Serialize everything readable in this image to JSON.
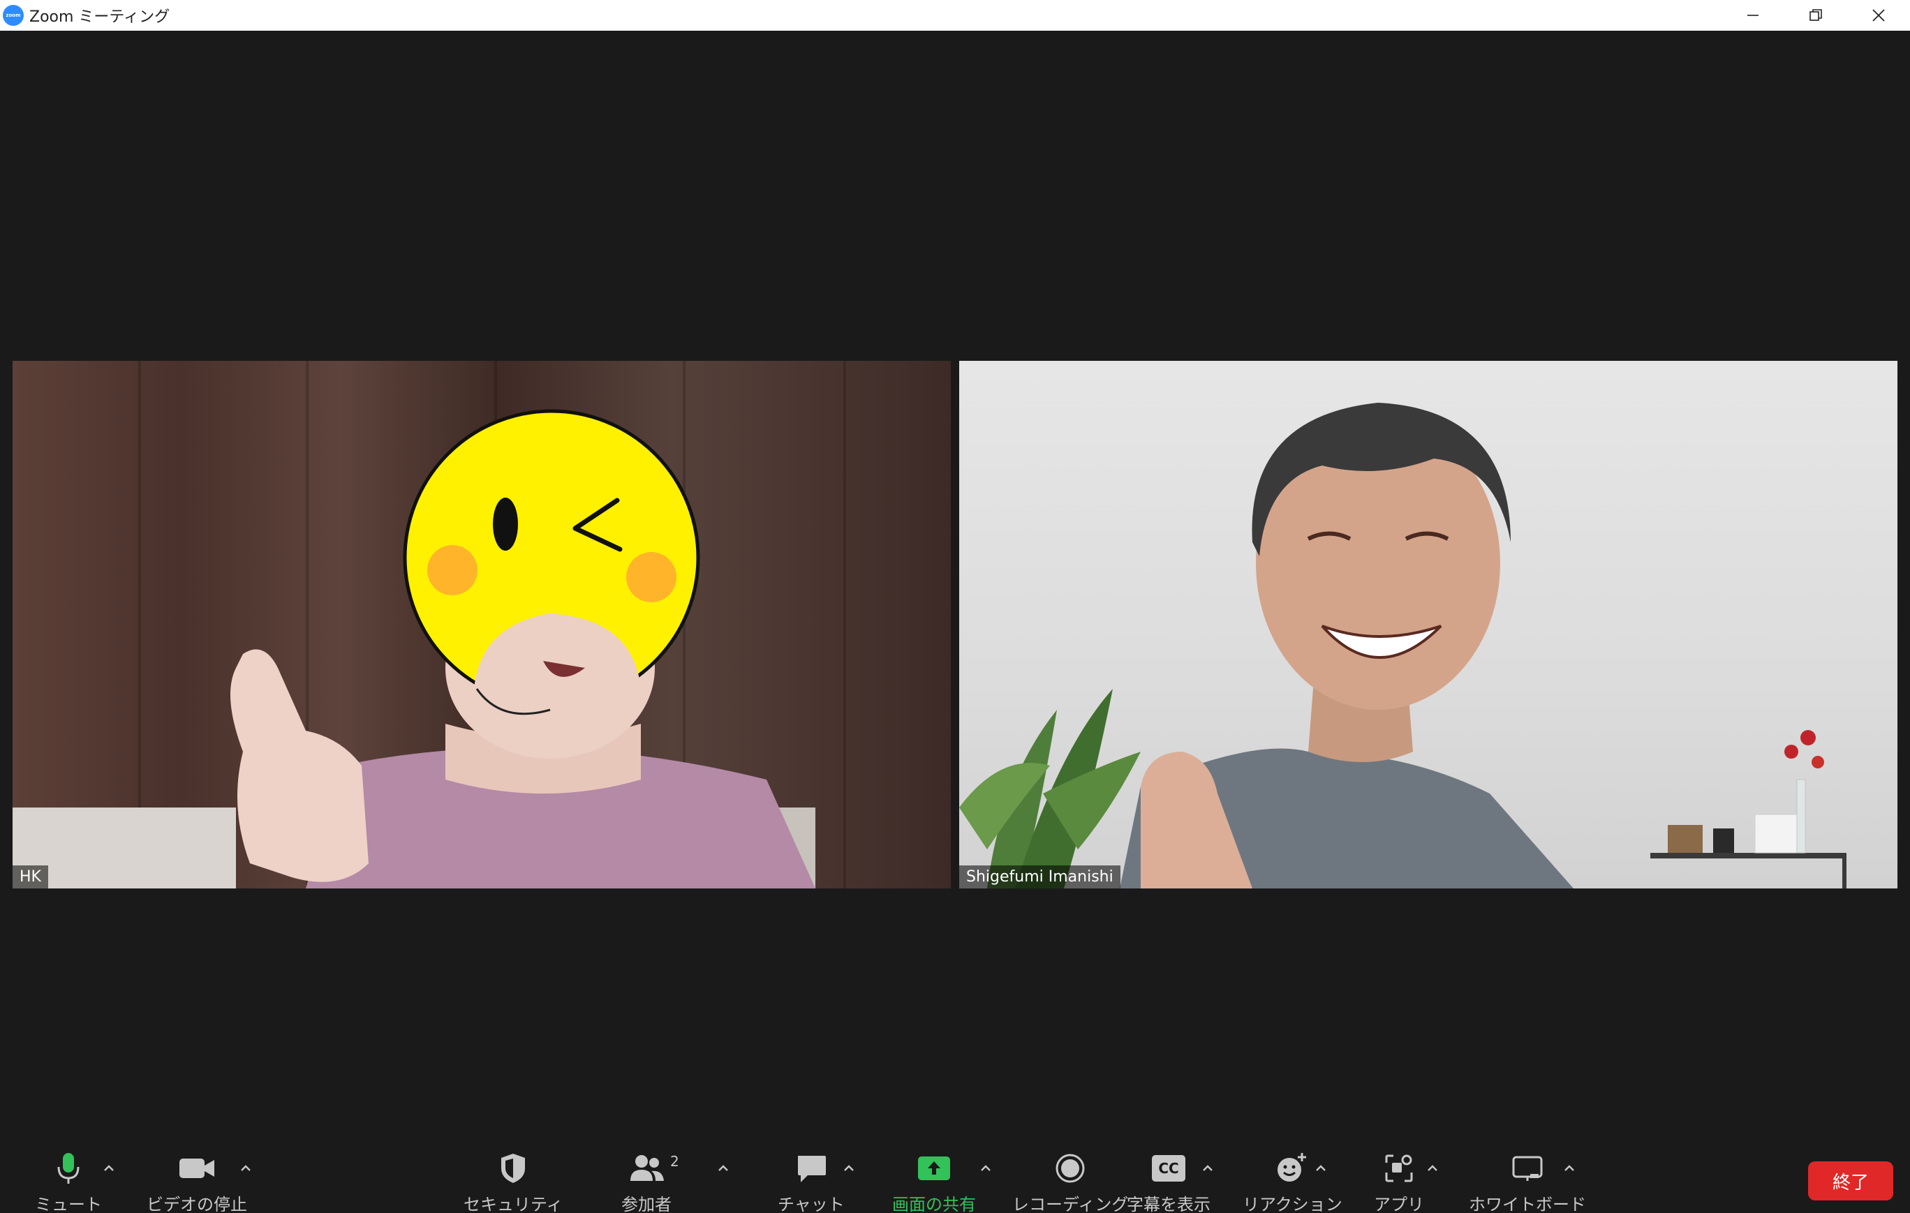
{
  "window": {
    "title": "Zoom ミーティング",
    "logo_text": "zoom"
  },
  "participants": [
    {
      "name": "HK"
    },
    {
      "name": "Shigefumi Imanishi"
    }
  ],
  "toolbar": {
    "mute_label": "ミュート",
    "video_label": "ビデオの停止",
    "security_label": "セキュリティ",
    "participants_label": "参加者",
    "participants_count": "2",
    "chat_label": "チャット",
    "share_label": "画面の共有",
    "record_label": "レコーディング",
    "captions_label": "字幕を表示",
    "captions_icon_text": "CC",
    "reactions_label": "リアクション",
    "apps_label": "アプリ",
    "whiteboard_label": "ホワイトボード",
    "end_label": "終了"
  },
  "colors": {
    "accent_green": "#33c15a",
    "end_red": "#e02828",
    "zoom_blue": "#2d8cff",
    "background": "#1a1a1b"
  }
}
